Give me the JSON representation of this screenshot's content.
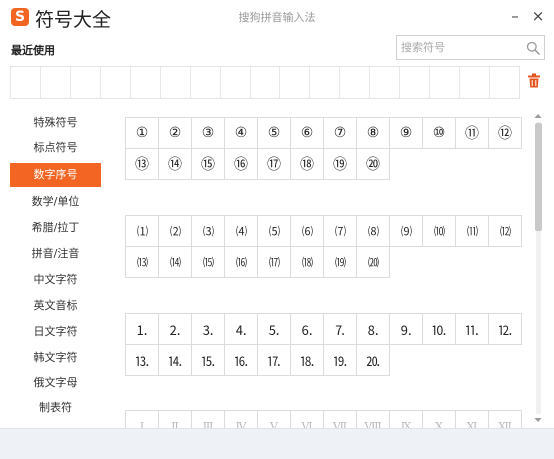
{
  "window": {
    "logo_char": "S",
    "title": "符号大全",
    "ime_name": "搜狗拼音输入法",
    "minimize_glyph": "–",
    "close_glyph": "×"
  },
  "recent": {
    "label": "最近使用",
    "cells": [
      "",
      "",
      "",
      "",
      "",
      "",
      "",
      "",
      "",
      "",
      "",
      "",
      "",
      "",
      "",
      "",
      ""
    ]
  },
  "search": {
    "placeholder": "搜索符号"
  },
  "icons": {
    "search": "search-icon",
    "trash": "trash-icon",
    "scroll_up": "chevron-up-icon",
    "scroll_down": "chevron-down-icon"
  },
  "colors": {
    "accent": "#f26522",
    "trash": "#e8541e",
    "footer": "#eef1f6",
    "cell_border": "#dcdcdc"
  },
  "sidebar": {
    "active_index": 2,
    "items": [
      {
        "label": "特殊符号"
      },
      {
        "label": "标点符号"
      },
      {
        "label": "数字序号"
      },
      {
        "label": "数学/单位"
      },
      {
        "label": "希腊/拉丁"
      },
      {
        "label": "拼音/注音"
      },
      {
        "label": "中文字符"
      },
      {
        "label": "英文音标"
      },
      {
        "label": "日文字符"
      },
      {
        "label": "韩文字符"
      },
      {
        "label": "俄文字母"
      },
      {
        "label": "制表符"
      }
    ]
  },
  "groups": [
    {
      "symbols": [
        "①",
        "②",
        "③",
        "④",
        "⑤",
        "⑥",
        "⑦",
        "⑧",
        "⑨",
        "⑩",
        "⑪",
        "⑫",
        "⑬",
        "⑭",
        "⑮",
        "⑯",
        "⑰",
        "⑱",
        "⑲",
        "⑳"
      ]
    },
    {
      "symbols": [
        "⑴",
        "⑵",
        "⑶",
        "⑷",
        "⑸",
        "⑹",
        "⑺",
        "⑻",
        "⑼",
        "⑽",
        "⑾",
        "⑿",
        "⒀",
        "⒁",
        "⒂",
        "⒃",
        "⒄",
        "⒅",
        "⒆",
        "⒇"
      ]
    },
    {
      "symbols": [
        "⒈",
        "⒉",
        "⒊",
        "⒋",
        "⒌",
        "⒍",
        "⒎",
        "⒏",
        "⒐",
        "⒑",
        "⒒",
        "⒓",
        "⒔",
        "⒕",
        "⒖",
        "⒗",
        "⒘",
        "⒙",
        "⒚",
        "⒛"
      ]
    },
    {
      "symbols": [
        "Ⅰ",
        "Ⅱ",
        "Ⅲ",
        "Ⅳ",
        "Ⅴ",
        "Ⅵ",
        "Ⅶ",
        "Ⅷ",
        "Ⅸ",
        "Ⅹ",
        "Ⅺ",
        "Ⅻ"
      ]
    }
  ]
}
